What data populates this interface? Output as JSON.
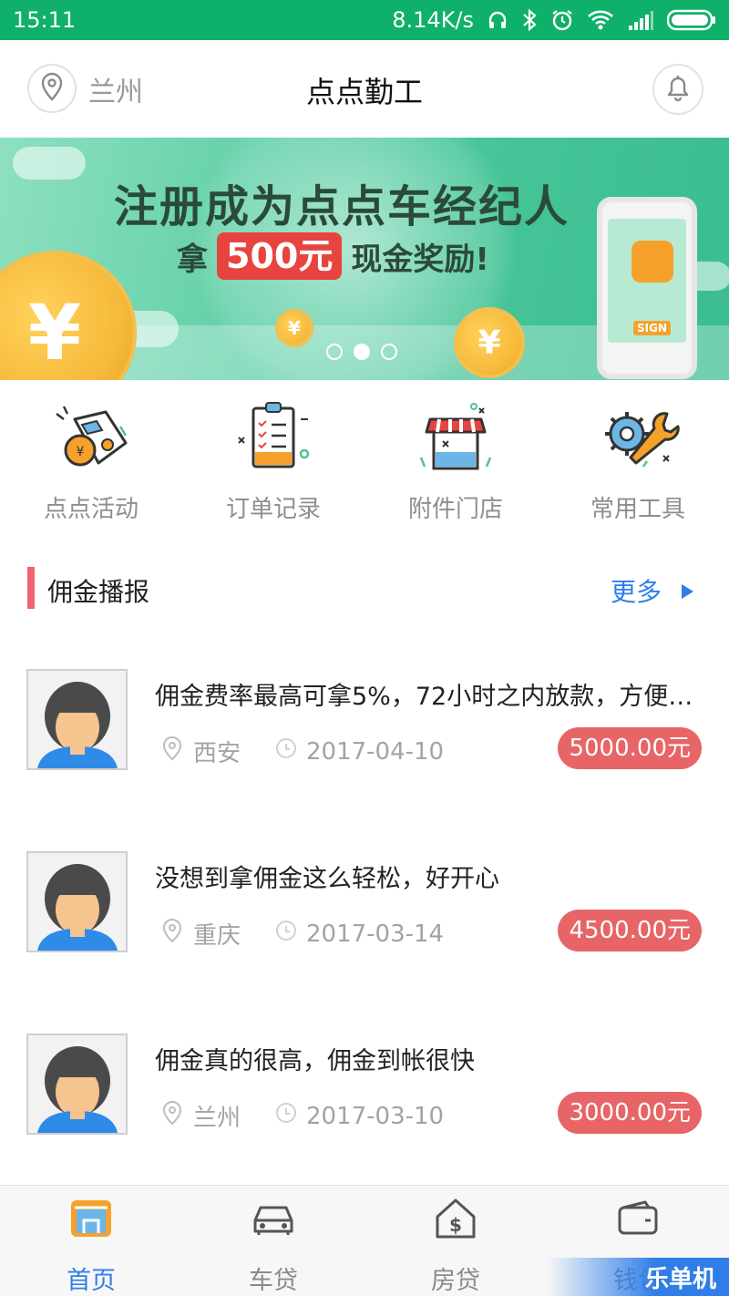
{
  "status_bar": {
    "time": "15:11",
    "network_speed": "8.14K/s",
    "icons": [
      "headset-icon",
      "bluetooth-icon",
      "alarm-icon",
      "wifi-icon",
      "signal-icon",
      "battery-icon"
    ]
  },
  "header": {
    "city": "兰州",
    "title": "点点勤工",
    "location_icon": "location-pin-icon",
    "bell_icon": "bell-icon"
  },
  "banner": {
    "headline": "注册成为点点车经纪人",
    "sub_prefix": "拿",
    "sub_amount": "500元",
    "sub_suffix": "现金奖励!",
    "coin_symbol": "¥",
    "phone_sign": "SIGN",
    "active_dot": 1,
    "dot_count": 3
  },
  "quick_menu": [
    {
      "label": "点点活动",
      "icon": "car-tag-icon"
    },
    {
      "label": "订单记录",
      "icon": "clipboard-icon"
    },
    {
      "label": "附件门店",
      "icon": "store-icon"
    },
    {
      "label": "常用工具",
      "icon": "tools-icon"
    }
  ],
  "section": {
    "title": "佣金播报",
    "more": "更多"
  },
  "feed": [
    {
      "text": "佣金费率最高可拿5%，72小时之内放款，方便…",
      "city": "西安",
      "date": "2017-04-10",
      "amount": "5000.00元"
    },
    {
      "text": "没想到拿佣金这么轻松，好开心",
      "city": "重庆",
      "date": "2017-03-14",
      "amount": "4500.00元"
    },
    {
      "text": "佣金真的很高，佣金到帐很快",
      "city": "兰州",
      "date": "2017-03-10",
      "amount": "3000.00元"
    }
  ],
  "bottom_nav": [
    {
      "label": "首页",
      "icon": "home-icon",
      "active": true
    },
    {
      "label": "车贷",
      "icon": "car-icon",
      "active": false
    },
    {
      "label": "房贷",
      "icon": "house-dollar-icon",
      "active": false
    },
    {
      "label": "钱包",
      "icon": "wallet-icon",
      "active": false
    }
  ],
  "watermark": "乐单机",
  "colors": {
    "status_green": "#0fb06a",
    "accent_blue": "#2f7ee8",
    "price_red": "#e76566",
    "section_bar": "#ef6470"
  }
}
